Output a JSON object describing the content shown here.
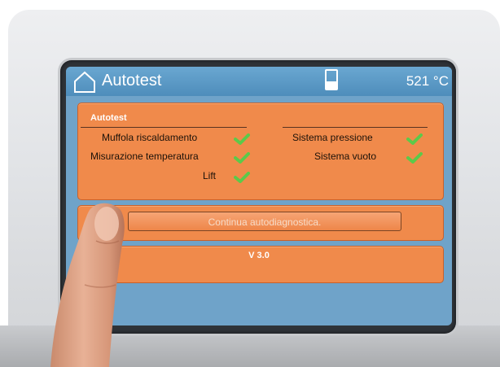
{
  "header": {
    "title": "Autotest",
    "temperature": "521 °C",
    "icon": "home-icon"
  },
  "status_panel": {
    "title": "Autotest",
    "left_items": [
      {
        "label": "Muffola riscaldamento",
        "status": "ok"
      },
      {
        "label": "Misurazione temperatura",
        "status": "ok"
      },
      {
        "label": "Lift",
        "status": "ok"
      }
    ],
    "right_items": [
      {
        "label": "Sistema pressione",
        "status": "ok"
      },
      {
        "label": "Sistema vuoto",
        "status": "ok"
      }
    ]
  },
  "actions": {
    "continue_label": "Continua autodiagnostica."
  },
  "footer": {
    "version": "V 3.0"
  },
  "colors": {
    "panel": "#f08a4b",
    "titlebar": "#4e8dbb",
    "check": "#5cc94a"
  }
}
